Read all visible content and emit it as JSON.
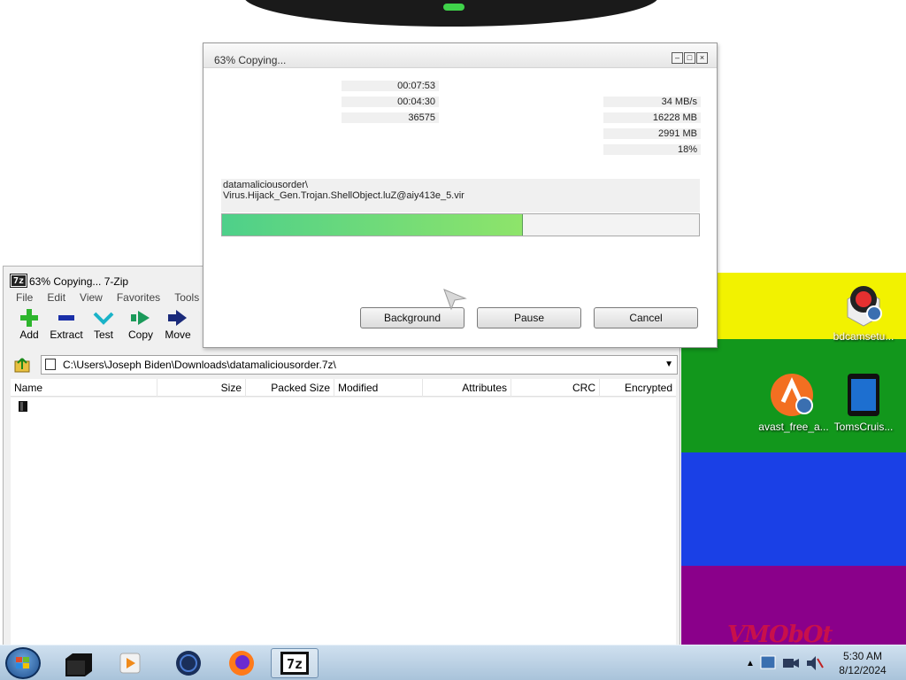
{
  "desktop": {
    "icons": [
      {
        "label": "bdcamsetu..."
      },
      {
        "label": "avast_free_a..."
      },
      {
        "label": "TomsCruis..."
      }
    ],
    "logo_text": "VMObOt"
  },
  "copy_dialog": {
    "title": "63% Copying...",
    "elapsed_time": "00:07:53",
    "remaining_time": "00:04:30",
    "files": "36575",
    "speed": "34 MB/s",
    "total_size": "16228 MB",
    "processed": "2991 MB",
    "compression_ratio": "18%",
    "current_path": "datamaliciousorder\\",
    "current_file": "Virus.Hijack_Gen.Trojan.ShellObject.luZ@aiy413e_5.vir",
    "progress_fraction": 0.63,
    "buttons": {
      "background": "Background",
      "pause": "Pause",
      "cancel": "Cancel"
    }
  },
  "zip_window": {
    "title": "63% Copying... 7-Zip",
    "menu": [
      "File",
      "Edit",
      "View",
      "Favorites",
      "Tools"
    ],
    "toolbar": [
      "Add",
      "Extract",
      "Test",
      "Copy",
      "Move"
    ],
    "address": "C:\\Users\\Joseph Biden\\Downloads\\datamaliciousorder.7z\\",
    "columns": [
      "Name",
      "Size",
      "Packed Size",
      "Modified",
      "Attributes",
      "CRC",
      "Encrypted"
    ]
  },
  "taskbar": {
    "time": "5:30 AM",
    "date": "8/12/2024",
    "apps": [
      "file-manager",
      "media-player",
      "world-globe",
      "firefox",
      "7-zip"
    ]
  },
  "colors": {
    "stripe_yellow": "#f2f200",
    "stripe_green": "#12971c",
    "stripe_blue": "#1a40e6",
    "stripe_purple": "#8a008a",
    "progress": "#6ed87a"
  }
}
